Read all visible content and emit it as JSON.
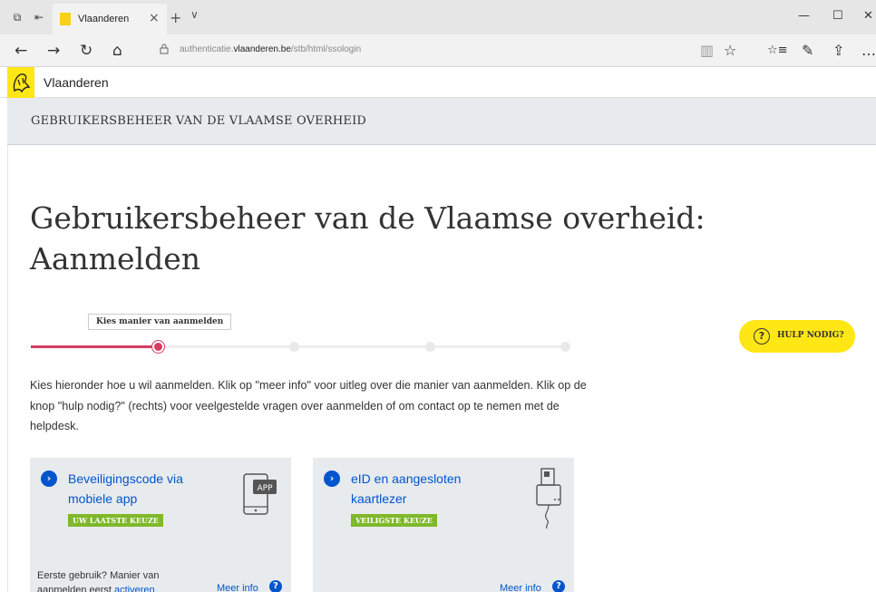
{
  "browser": {
    "tab_title": "Vlaanderen",
    "tab_close": "×",
    "new_tab": "+",
    "tab_menu": "∨",
    "minimize": "—",
    "maximize": "☐",
    "close": "✕",
    "url_prefix": "authenticatie.",
    "url_domain": "vlaanderen.be",
    "url_path": "/stb/html/ssologin",
    "back": "←",
    "forward": "→",
    "refresh": "↻",
    "home": "⌂",
    "reading_view": "▥",
    "favorite": "☆",
    "favorites_hub": "☆≡",
    "notes": "✎",
    "share": "⇪",
    "more": "…"
  },
  "site": {
    "name": "Vlaanderen",
    "banner": "GEBRUIKERSBEHEER VAN DE VLAAMSE OVERHEID"
  },
  "main": {
    "title": "Gebruikersbeheer van de Vlaamse overheid: Aanmelden",
    "step_tooltip": "Kies manier van aanmelden",
    "progress": {
      "current_step": 1,
      "total_steps": 4,
      "fill_fraction": 0.25
    },
    "help_button": "HULP NODIG?",
    "help_icon": "?",
    "intro": "Kies hieronder hoe u wil aanmelden. Klik op \"meer info\" voor uitleg over die manier van aanmelden. Klik op de knop \"hulp nodig?\" (rechts) voor veelgestelde vragen over aanmelden of om contact op te nemen met de helpdesk."
  },
  "cards": [
    {
      "title": "Beveiligingscode via mobiele app",
      "badge": "UW LAATSTE KEUZE",
      "icon": "phone-app-icon",
      "icon_text": "APP",
      "footer_text": "Eerste gebruik? Manier van aanmelden eerst ",
      "footer_link": "activeren",
      "more_info": "Meer info"
    },
    {
      "title": "eID en aangesloten kaartlezer",
      "badge": "VEILIGSTE KEUZE",
      "icon": "card-reader-icon",
      "more_info": "Meer info"
    }
  ],
  "colors": {
    "accent_blue": "#0055cc",
    "yellow": "#ffe615",
    "progress_red": "#d63d62",
    "badge_green": "#7fb82a",
    "grey_panel": "#e8ebee"
  }
}
